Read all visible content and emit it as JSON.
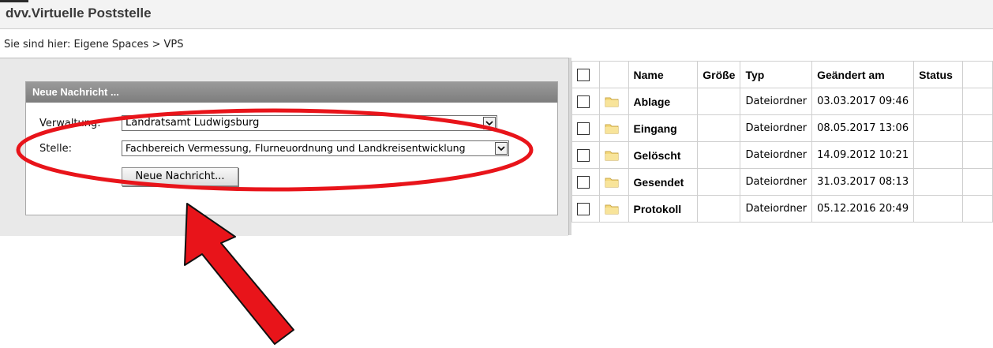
{
  "app": {
    "title": "dvv.Virtuelle Poststelle"
  },
  "breadcrumb": {
    "text": "Sie sind hier: Eigene Spaces > VPS"
  },
  "panel": {
    "header": "Neue Nachricht ...",
    "verwaltung_label": "Verwaltung:",
    "verwaltung_value": "Landratsamt Ludwigsburg",
    "stelle_label": "Stelle:",
    "stelle_value": "Fachbereich Vermessung, Flurneuordnung und Landkreisentwicklung",
    "button_label": "Neue Nachricht..."
  },
  "table": {
    "columns": [
      "Name",
      "Größe",
      "Typ",
      "Geändert am",
      "Status"
    ],
    "rows": [
      {
        "name": "Ablage",
        "size": "",
        "type": "Dateiordner",
        "modified": "03.03.2017 09:46",
        "status": ""
      },
      {
        "name": "Eingang",
        "size": "",
        "type": "Dateiordner",
        "modified": "08.05.2017 13:06",
        "status": ""
      },
      {
        "name": "Gelöscht",
        "size": "",
        "type": "Dateiordner",
        "modified": "14.09.2012 10:21",
        "status": ""
      },
      {
        "name": "Gesendet",
        "size": "",
        "type": "Dateiordner",
        "modified": "31.03.2017 08:13",
        "status": ""
      },
      {
        "name": "Protokoll",
        "size": "",
        "type": "Dateiordner",
        "modified": "05.12.2016 20:49",
        "status": ""
      }
    ]
  },
  "icons": {
    "folder": "folder-icon",
    "dropdown": "chevron-down-icon"
  },
  "colors": {
    "annotation_red": "#e8141a",
    "folder_yellow": "#f5d97a"
  }
}
